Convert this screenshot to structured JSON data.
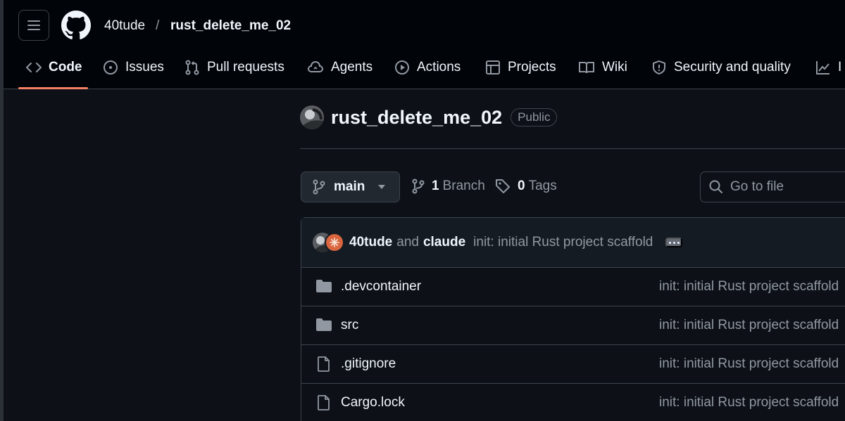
{
  "header": {
    "owner": "40tude",
    "separator": "/",
    "repo": "rust_delete_me_02"
  },
  "tabs": [
    {
      "label": "Code",
      "icon": "code-icon",
      "active": true
    },
    {
      "label": "Issues",
      "icon": "issue-icon"
    },
    {
      "label": "Pull requests",
      "icon": "pull-request-icon"
    },
    {
      "label": "Agents",
      "icon": "agents-icon"
    },
    {
      "label": "Actions",
      "icon": "play-icon"
    },
    {
      "label": "Projects",
      "icon": "table-icon"
    },
    {
      "label": "Wiki",
      "icon": "book-icon"
    },
    {
      "label": "Security and quality",
      "icon": "shield-icon"
    },
    {
      "label": "I",
      "icon": "graph-icon"
    }
  ],
  "repo": {
    "name": "rust_delete_me_02",
    "visibility": "Public"
  },
  "branch": {
    "current": "main",
    "branch_count": "1",
    "branch_label": "Branch",
    "tag_count": "0",
    "tag_label": "Tags"
  },
  "search": {
    "placeholder": "Go to file"
  },
  "commit": {
    "author1": "40tude",
    "and": "and",
    "author2": "claude",
    "message": "init: initial Rust project scaffold"
  },
  "files": [
    {
      "name": ".devcontainer",
      "type": "folder",
      "message": "init: initial Rust project scaffold"
    },
    {
      "name": "src",
      "type": "folder",
      "message": "init: initial Rust project scaffold"
    },
    {
      "name": ".gitignore",
      "type": "file",
      "message": "init: initial Rust project scaffold"
    },
    {
      "name": "Cargo.lock",
      "type": "file",
      "message": "init: initial Rust project scaffold"
    }
  ],
  "colors": {
    "background": "#0d1117",
    "header": "#010409",
    "accent_underline": "#f78166",
    "muted_text": "#9198a1",
    "border": "#3d444d"
  }
}
